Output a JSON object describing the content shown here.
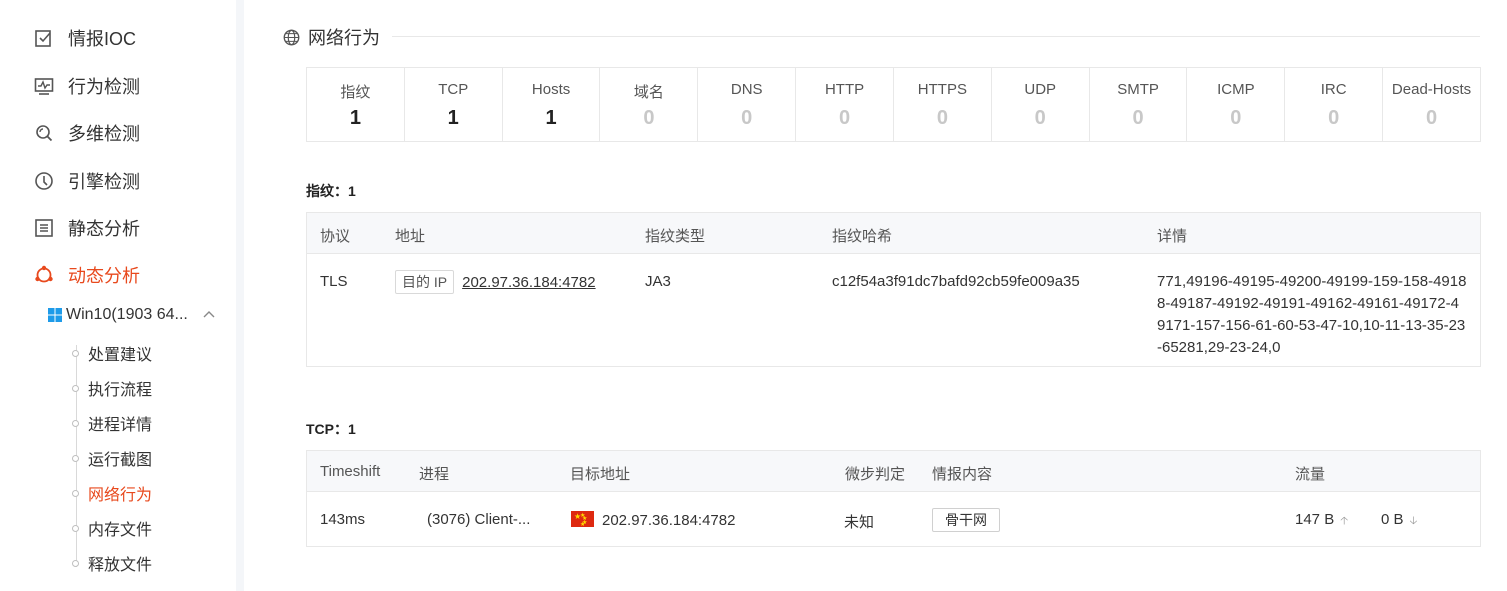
{
  "sidebar": {
    "items": [
      {
        "label": "情报IOC",
        "icon": "checklist-icon"
      },
      {
        "label": "行为检测",
        "icon": "waveform-icon"
      },
      {
        "label": "多维检测",
        "icon": "search-cycle-icon"
      },
      {
        "label": "引擎检测",
        "icon": "engine-icon"
      },
      {
        "label": "静态分析",
        "icon": "list-icon"
      },
      {
        "label": "动态分析",
        "icon": "ubuntu-icon",
        "active": true
      }
    ],
    "sub_parent": "Win10(1903 64...",
    "sub_items": [
      "处置建议",
      "执行流程",
      "进程详情",
      "运行截图",
      "网络行为",
      "内存文件",
      "释放文件"
    ],
    "active_sub": "网络行为"
  },
  "section": {
    "title": "网络行为"
  },
  "stats": [
    {
      "name": "指纹",
      "value": "1"
    },
    {
      "name": "TCP",
      "value": "1"
    },
    {
      "name": "Hosts",
      "value": "1"
    },
    {
      "name": "域名",
      "value": "0"
    },
    {
      "name": "DNS",
      "value": "0"
    },
    {
      "name": "HTTP",
      "value": "0"
    },
    {
      "name": "HTTPS",
      "value": "0"
    },
    {
      "name": "UDP",
      "value": "0"
    },
    {
      "name": "SMTP",
      "value": "0"
    },
    {
      "name": "ICMP",
      "value": "0"
    },
    {
      "name": "IRC",
      "value": "0"
    },
    {
      "name": "Dead-Hosts",
      "value": "0"
    }
  ],
  "fingerprint": {
    "title": "指纹：1",
    "headers": [
      "协议",
      "地址",
      "指纹类型",
      "指纹哈希",
      "详情"
    ],
    "row": {
      "protocol": "TLS",
      "addr_tag": "目的 IP",
      "address": "202.97.36.184:4782",
      "type": "JA3",
      "hash": "c12f54a3f91dc7bafd92cb59fe009a35",
      "details": "771,49196-49195-49200-49199-159-158-49188-49187-49192-49191-49162-49161-49172-49171-157-156-61-60-53-47-10,10-11-13-35-23-65281,29-23-24,0"
    }
  },
  "tcp": {
    "title": "TCP：1",
    "headers": [
      "Timeshift",
      "进程",
      "目标地址",
      "微步判定",
      "情报内容",
      "流量"
    ],
    "row": {
      "timeshift": "143ms",
      "process": "(3076)  Client-...",
      "target": "202.97.36.184:4782",
      "verdict": "未知",
      "intel": "骨干网",
      "up": "147 B",
      "down": "0 B"
    }
  },
  "colors": {
    "accent": "#e8491d",
    "flag_red": "#de2910",
    "flag_star": "#ffde00"
  }
}
